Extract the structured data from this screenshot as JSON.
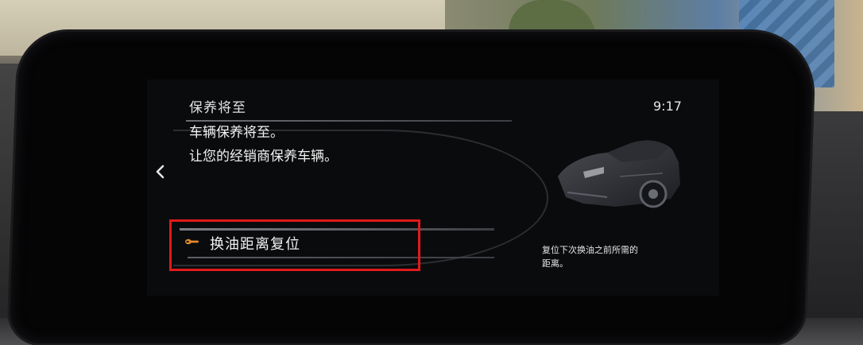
{
  "screen": {
    "title": "保养将至",
    "clock": "9:17",
    "message_lines": [
      "车辆保养将至。",
      "让您的经销商保养车辆。"
    ],
    "back_icon": "chevron-left-icon",
    "menu": {
      "item_label": "换油距离复位",
      "item_icon": "wrench-icon",
      "icon_color": "#e08a2a"
    },
    "help_lines": [
      "复位下次换油之前所需的",
      "距离。"
    ],
    "highlight_color": "#e11a1a"
  }
}
